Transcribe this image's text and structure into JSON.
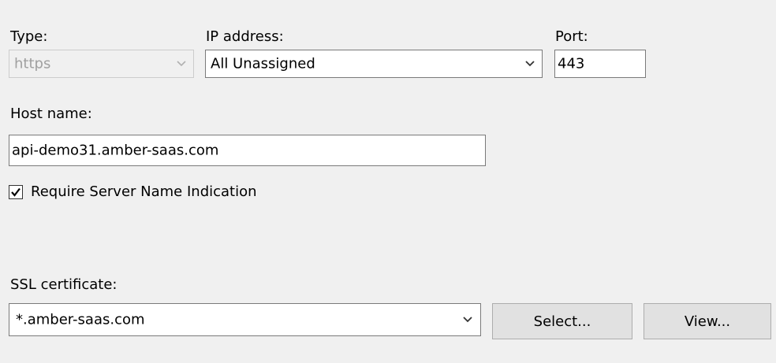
{
  "type": {
    "label": "Type:",
    "value": "https",
    "disabled": true
  },
  "ip": {
    "label": "IP address:",
    "value": "All Unassigned"
  },
  "port": {
    "label": "Port:",
    "value": "443"
  },
  "host": {
    "label": "Host name:",
    "value": "api-demo31.amber-saas.com"
  },
  "sni": {
    "label": "Require Server Name Indication",
    "checked": true
  },
  "ssl": {
    "label": "SSL certificate:",
    "value": "*.amber-saas.com",
    "select_label": "Select...",
    "view_label": "View..."
  },
  "icons": {
    "dropdown": "chevron-down-icon",
    "check": "checkmark-icon"
  }
}
